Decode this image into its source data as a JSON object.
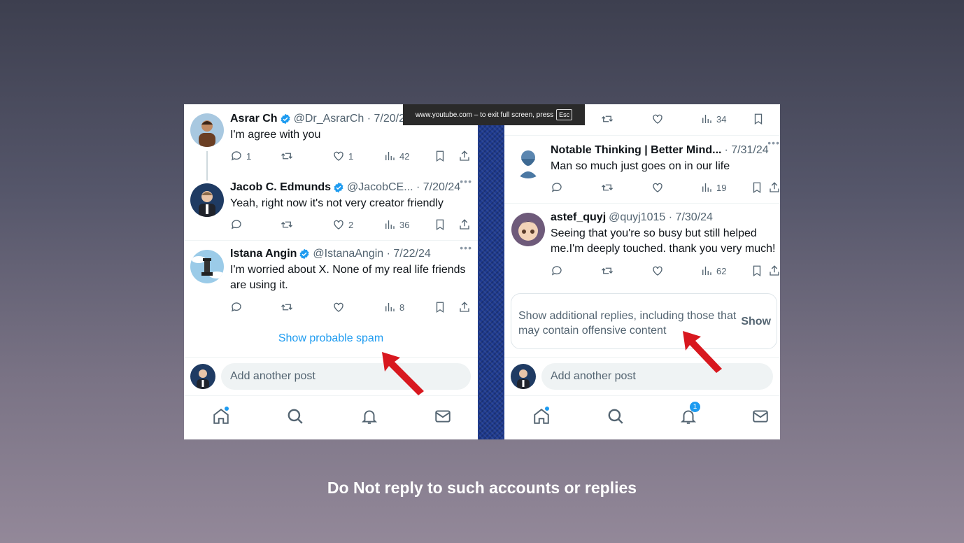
{
  "banner": {
    "text": "www.youtube.com – to exit full screen, press",
    "key": "Esc"
  },
  "left_panel": {
    "tweets": [
      {
        "name": "Asrar Ch",
        "handle": "@Dr_AsrarCh · 7/20/24",
        "text": "I'm agree with you",
        "replies": "1",
        "likes": "1",
        "views": "42"
      },
      {
        "name": "Jacob C. Edmunds",
        "handle": "@JacobCE... · 7/20/24",
        "text": "Yeah, right now it's not very creator friendly",
        "replies": "",
        "likes": "2",
        "views": "36"
      },
      {
        "name": "Istana Angin",
        "handle": "@IstanaAngin · 7/22/24",
        "text": "I'm worried about X. None of my real life friends are using it.",
        "replies": "",
        "likes": "",
        "views": "8"
      }
    ],
    "show_spam": "Show probable spam",
    "compose_placeholder": "Add another post"
  },
  "right_panel": {
    "top_views": "34",
    "tweets": [
      {
        "name": "Notable Thinking | Better Mind...",
        "handle": "· 7/31/24",
        "text": "Man so much just goes on in our life",
        "views": "19"
      },
      {
        "name": "astef_quyj",
        "handle": "@quyj1015 · 7/30/24",
        "text": "Seeing that you're so busy but still helped me.I'm deeply touched. thank you very much!",
        "views": "62"
      }
    ],
    "more_replies_text": "Show additional replies, including those that may contain offensive content",
    "more_replies_button": "Show",
    "compose_placeholder": "Add another post",
    "notification_count": "1"
  },
  "caption": "Do Not reply to such accounts or replies",
  "colors": {
    "accent": "#1d9bf0",
    "arrow": "#d8181f"
  }
}
